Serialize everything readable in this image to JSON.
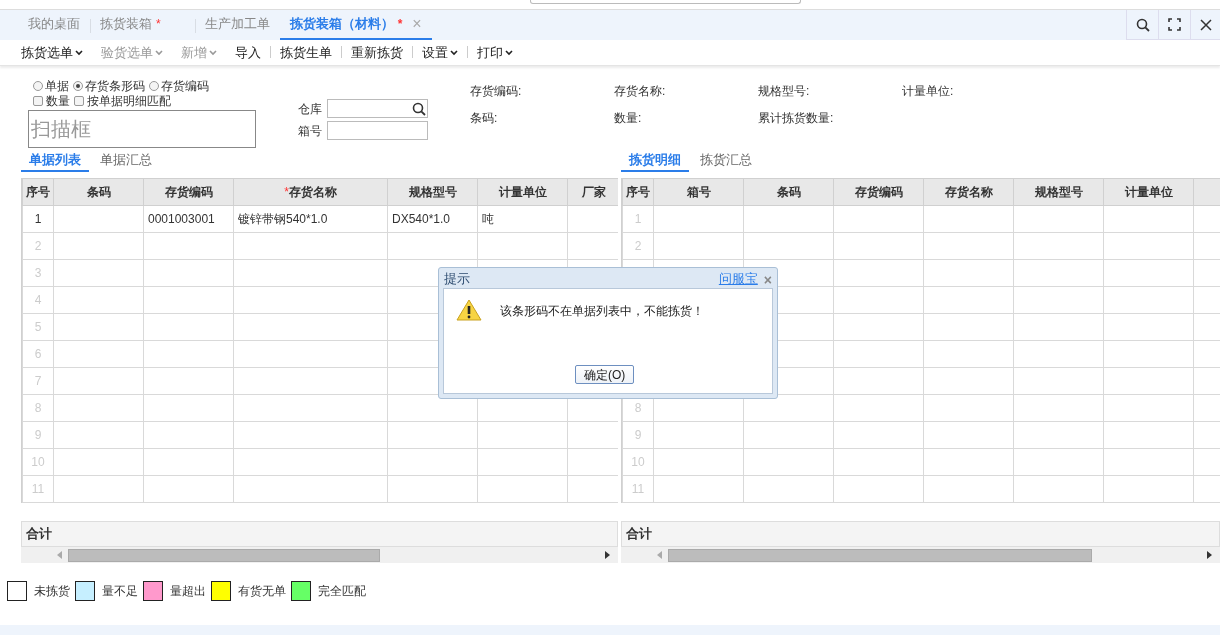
{
  "tabs": [
    {
      "label": "我的桌面",
      "selected": false
    },
    {
      "label": "拣货装箱",
      "asterisk": "*",
      "selected": false
    },
    {
      "label": "生产加工单",
      "selected": false
    },
    {
      "label": "拣货装箱（材料）",
      "asterisk": "*",
      "selected": true,
      "close": "×"
    }
  ],
  "toolbar": [
    {
      "label": "拣货选单",
      "dropdown": true,
      "disabled": false,
      "divider_before": false
    },
    {
      "label": "验货选单",
      "dropdown": true,
      "disabled": true,
      "divider_before": false
    },
    {
      "label": "新增",
      "dropdown": true,
      "disabled": true,
      "divider_before": false
    },
    {
      "label": "导入",
      "dropdown": false,
      "disabled": false,
      "divider_before": false
    },
    {
      "label": "拣货生单",
      "dropdown": false,
      "disabled": false,
      "divider_before": true
    },
    {
      "label": "重新拣货",
      "dropdown": false,
      "disabled": false,
      "divider_before": true
    },
    {
      "label": "设置",
      "dropdown": true,
      "disabled": false,
      "divider_before": true
    },
    {
      "label": "打印",
      "dropdown": true,
      "disabled": false,
      "divider_before": true
    }
  ],
  "scan_mode": [
    {
      "label": "单据",
      "selected": false
    },
    {
      "label": "存货条形码",
      "selected": true
    },
    {
      "label": "存货编码",
      "selected": false
    }
  ],
  "options": [
    {
      "label": "数量",
      "checked": false
    },
    {
      "label": "按单据明细匹配",
      "checked": false
    }
  ],
  "scan_box": {
    "placeholder": "扫描框"
  },
  "warehouse": {
    "label": "仓库"
  },
  "box_no": {
    "label": "箱号"
  },
  "info": [
    {
      "label": "存货编码:"
    },
    {
      "label": "存货名称:"
    },
    {
      "label": "规格型号:"
    },
    {
      "label": "计量单位:"
    },
    {
      "label": "条码:"
    },
    {
      "label": "数量:"
    },
    {
      "label": "累计拣货数量:"
    }
  ],
  "left": {
    "tabs": [
      {
        "label": "单据列表",
        "selected": true
      },
      {
        "label": "单据汇总",
        "selected": false
      }
    ],
    "columns": [
      {
        "label": "序号"
      },
      {
        "label": "条码"
      },
      {
        "label": "存货编码"
      },
      {
        "label": "存货名称",
        "asterisk": "*"
      },
      {
        "label": "规格型号"
      },
      {
        "label": "计量单位"
      },
      {
        "label": "厂家"
      }
    ],
    "rows": [
      {
        "no": "1",
        "filled": true,
        "cells": [
          null,
          "0001003001",
          "镀锌带钢540*1.0",
          "DX540*1.0",
          "吨",
          null
        ]
      },
      {
        "no": "2",
        "filled": false
      },
      {
        "no": "3",
        "filled": false
      },
      {
        "no": "4",
        "filled": false
      },
      {
        "no": "5",
        "filled": false
      },
      {
        "no": "6",
        "filled": false
      },
      {
        "no": "7",
        "filled": false
      },
      {
        "no": "8",
        "filled": false
      },
      {
        "no": "9",
        "filled": false
      },
      {
        "no": "10",
        "filled": false
      },
      {
        "no": "11",
        "filled": false
      }
    ],
    "total_label": "合计"
  },
  "right": {
    "tabs": [
      {
        "label": "拣货明细",
        "selected": true
      },
      {
        "label": "拣货汇总",
        "selected": false
      }
    ],
    "columns": [
      {
        "label": "序号"
      },
      {
        "label": "箱号"
      },
      {
        "label": "条码"
      },
      {
        "label": "存货编码"
      },
      {
        "label": "存货名称"
      },
      {
        "label": "规格型号"
      },
      {
        "label": "计量单位"
      }
    ],
    "rows": [
      {
        "kind": "row",
        "no": "1",
        "filled": false
      },
      {
        "kind": "row",
        "no": "2",
        "filled": false
      },
      {
        "kind": "covered"
      },
      {
        "kind": "covered"
      },
      {
        "kind": "covered"
      },
      {
        "kind": "covered"
      },
      {
        "kind": "covered"
      },
      {
        "kind": "row",
        "no": "8",
        "filled": false
      },
      {
        "no": "9",
        "filled": false
      },
      {
        "no": "10",
        "filled": false
      },
      {
        "no": "11",
        "filled": false
      }
    ],
    "total_label": "合计"
  },
  "legend": [
    {
      "label": "未拣货",
      "color": "#ffffff"
    },
    {
      "label": "量不足",
      "color": "#c6efff"
    },
    {
      "label": "量超出",
      "color": "#ff99cc"
    },
    {
      "label": "有货无单",
      "color": "#ffff00"
    },
    {
      "label": "完全匹配",
      "color": "#66ff66"
    }
  ],
  "dialog": {
    "title": "提示",
    "link": "问服宝",
    "close": "×",
    "message": "该条形码不在单据列表中，不能拣货！",
    "button": "确定(O)"
  }
}
